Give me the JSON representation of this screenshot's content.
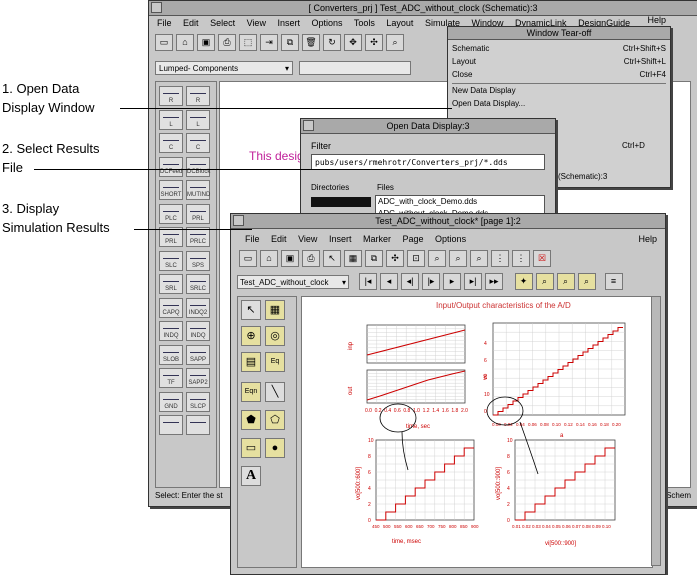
{
  "annotations": {
    "step1_line1": "1. Open Data",
    "step1_line2": "Display Window",
    "step2_line1": "2. Select Results",
    "step2_line2": "File",
    "step3_line1": "3. Display",
    "step3_line2": "Simulation Results"
  },
  "schematic": {
    "title": "[ Converters_prj ] Test_ADC_without_clock (Schematic):3",
    "menu": [
      "File",
      "Edit",
      "Select",
      "View",
      "Insert",
      "Options",
      "Tools",
      "Layout",
      "Simulate",
      "Window",
      "DynamicLink",
      "DesignGuide"
    ],
    "palette_dropdown": "Lumped- Components",
    "design_text": "This desig",
    "status": "Select: Enter the st",
    "status_right": "nsSchem",
    "palette_items": [
      "R",
      "R",
      "L",
      "L",
      "C",
      "C",
      "DCFeed",
      "DCBlock",
      "SHORT",
      "MUTIND",
      "PLC",
      "PRL",
      "PRL",
      "PRLC",
      "SLC",
      "SPS",
      "SRL",
      "SRLC",
      "CAPQ",
      "INDQ2",
      "INDQ",
      "INDQ",
      "SLOB",
      "SAPP",
      "TF",
      "SAPP2",
      "GND",
      "SLCP",
      "",
      ""
    ]
  },
  "window_menu": {
    "title": "Window Tear-off",
    "help": "Help",
    "items": [
      {
        "label": "Schematic",
        "shortcut": "Ctrl+Shift+S"
      },
      {
        "label": "Layout",
        "shortcut": "Ctrl+Shift+L"
      },
      {
        "label": "Close",
        "shortcut": "Ctrl+F4"
      },
      {
        "label": "New Data Display",
        "shortcut": ""
      },
      {
        "label": "Open Data Display...",
        "shortcut": ""
      },
      {
        "label": "",
        "shortcut": "Ctrl+D"
      },
      {
        "label": "(Schematic):3",
        "shortcut": ""
      }
    ]
  },
  "open_dialog": {
    "title": "Open Data Display:3",
    "filter_label": "Filter",
    "filter_value": "pubs/users/rmehrotr/Converters_prj/*.dds",
    "directories_label": "Directories",
    "files_label": "Files",
    "files": [
      "ADC_with_clock_Demo.dds",
      "ADC_without_clock_Demo.dds"
    ]
  },
  "display": {
    "title": "Test_ADC_without_clock* [page 1]:2",
    "menu": [
      "File",
      "Edit",
      "View",
      "Insert",
      "Marker",
      "Page",
      "Options"
    ],
    "help": "Help",
    "dataset": "Test_ADC_without_clock",
    "plot_title": "Input/Output characteristics of the A/D",
    "left_top_xlabel": "time, sec",
    "left_top_yl1": "inp",
    "left_top_yl2": "out",
    "right_top_xlabel": "a",
    "right_top_ylabel": "vo",
    "bottom_left_xlabel": "time, msec",
    "bottom_left_ylabel": "vo[500::600]",
    "bottom_right_xlabel": "vi[500::900]",
    "bottom_right_ylabel": "vo[500::900]",
    "left_top_ticks": [
      "0.0",
      "0.2",
      "0.4",
      "0.6",
      "0.8",
      "1.0",
      "1.2",
      "1.4",
      "1.6",
      "1.8",
      "2.0"
    ],
    "bottom_left_xticks": [
      "450",
      "500",
      "550",
      "600",
      "650",
      "700",
      "750",
      "800",
      "850",
      "900"
    ],
    "bottom_y_ticks": [
      "0",
      "2",
      "4",
      "6",
      "8",
      "10"
    ],
    "right_top_y_ticks": [
      "4",
      "6",
      "8",
      "10",
      "0"
    ],
    "right_top_x_ticks": [
      "0.00",
      "0.02",
      "0.04",
      "0.06",
      "0.08",
      "0.10",
      "0.12",
      "0.14",
      "0.16",
      "0.18",
      "0.20"
    ],
    "bottom_right_xticks": [
      "0.01",
      "0.02",
      "0.03",
      "0.04",
      "0.05",
      "0.06",
      "0.07",
      "0.08",
      "0.09",
      "0.10"
    ]
  }
}
